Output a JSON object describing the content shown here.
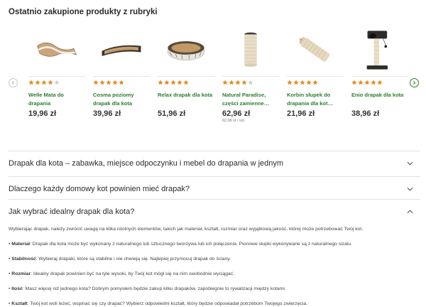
{
  "section": {
    "title": "Ostatnio zakupione produkty z rubryki"
  },
  "products": [
    {
      "name": "Welle Mata do drapania",
      "stars": 4,
      "price": "19,96 zł",
      "unit_price": "",
      "icon": "wave-scratcher-image"
    },
    {
      "name": "Cosma poziomy drapak dla kota",
      "stars": 5,
      "price": "39,96 zł",
      "unit_price": "",
      "icon": "flat-scratcher-image"
    },
    {
      "name": "Relax drapak dla kota",
      "stars": 5,
      "price": "51,96 zł",
      "unit_price": "",
      "icon": "round-scratcher-image"
    },
    {
      "name": "Natural Paradise, części zamienne…",
      "stars": 4,
      "price": "62,96 zł",
      "unit_price": "62,96 zł / szt.",
      "icon": "sisal-post-image"
    },
    {
      "name": "Korbin słupek do drapania dla kot…",
      "stars": 5,
      "price": "21,96 zł",
      "unit_price": "",
      "icon": "sisal-roll-image"
    },
    {
      "name": "Enio drapak dla kota",
      "stars": 5,
      "price": "38,96 zł",
      "unit_price": "",
      "icon": "cat-tree-image"
    }
  ],
  "colors": {
    "accent": "#2e7d32",
    "star": "#e08a1e",
    "star_empty": "#cfcfcf"
  },
  "faq": [
    {
      "question": "Drapak dla kota – zabawka, miejsce odpoczynku i mebel do drapania w jednym",
      "expanded": false
    },
    {
      "question": "Dlaczego każdy domowy kot powinien mieć drapak?",
      "expanded": false
    },
    {
      "question": "Jak wybrać idealny drapak dla kota?",
      "expanded": true
    }
  ],
  "answer": {
    "intro": "Wybierając drapak, należy zwrócić uwagę na kilka istotnych elementów, takich jak materiał, kształt, rozmiar oraz wyjątkową jakość, której może potrzebować Twój kot.",
    "bullets": [
      {
        "term": "Materiał",
        "text": ": Drapak dla kota może być wykonany z naturalnego lub sztucznego tworzywa lub ich połączenia. Pionowe słupki wykonywane są z naturalnego sizalu."
      },
      {
        "term": "Stabilność",
        "text": ": Wybieraj drapaki, które są stabilne i nie chwieją się. Najlepiej przymocuj drapak do ściany."
      },
      {
        "term": "Rozmiar",
        "text": ": Idealny drapak powinien być na tyle wysoki, by Twój kot mógł się na nim swobodnie wyciągać."
      },
      {
        "term": "Ilość",
        "text": ": Masz więcej niż jednego kota? Dobrym pomysłem będzie zakup kilku drapaków, zapobiegnie to rywalizacji między kotami."
      },
      {
        "term": "Kształt",
        "text": ": Twój kot woli leżeć, wspinać się czy drapać? Wybierz odpowiedni kształt, który będzie odpowiadał potrzebom Twojego zwierzęcia."
      }
    ]
  }
}
